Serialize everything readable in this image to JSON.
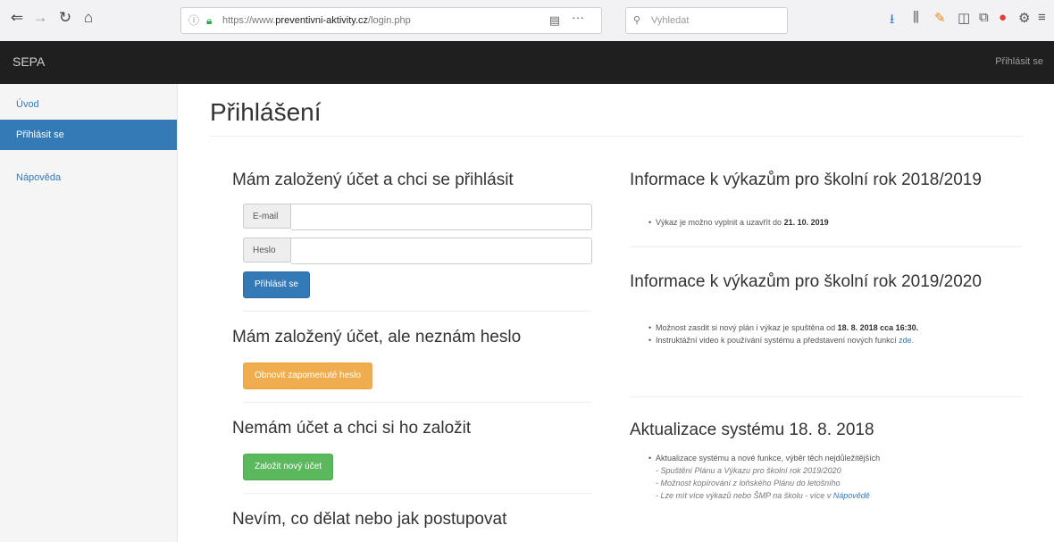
{
  "browser": {
    "url_prefix": "https://www.",
    "url_domain": "preventivni-aktivity.cz",
    "url_path": "/login.php",
    "search_placeholder": "Vyhledat"
  },
  "navbar": {
    "brand": "SEPA",
    "login_link": "Přihlásit se"
  },
  "sidebar": {
    "items": [
      {
        "label": "Úvod"
      },
      {
        "label": "Přihlásit se"
      },
      {
        "label": "Nápověda"
      }
    ]
  },
  "main": {
    "title": "Přihlášení",
    "login_section": {
      "heading": "Mám založený účet a chci se přihlásit",
      "email_label": "E-mail",
      "password_label": "Heslo",
      "submit_label": "Přihlásit se"
    },
    "forgot_section": {
      "heading": "Mám založený účet, ale neznám heslo",
      "button_label": "Obnovit zapomenuté heslo"
    },
    "register_section": {
      "heading": "Nemám účet a chci si ho založit",
      "button_label": "Založit nový účet"
    },
    "help_section": {
      "heading": "Nevím, co dělat nebo jak postupovat"
    },
    "info1": {
      "heading": "Informace k výkazům pro školní rok 2018/2019",
      "bullet_text": "Výkaz je možno vyplnit a uzavřít do ",
      "bullet_bold": "21. 10. 2019"
    },
    "info2": {
      "heading": "Informace k výkazům pro školní rok 2019/2020",
      "bullet1_text": "Možnost zasdit si nový plán i výkaz je spuštěna od ",
      "bullet1_bold": "18. 8. 2018 cca 16:30.",
      "bullet2_text": "Instruktážní video k používání systému a představení nových funkcí ",
      "bullet2_link": "zde."
    },
    "update": {
      "heading": "Aktualizace systému 18. 8. 2018",
      "bullet_text": "Aktualizace systému a nové funkce, výběr těch nejdůležitějších",
      "sub1": "- Spuštění Plánu a Výkazu pro školní rok 2019/2020",
      "sub2": "- Možnost kopírování z loňského Plánu do letošního",
      "sub3_text": "- Lze mít více výkazů nebo ŠMP na školu - více v ",
      "sub3_link": "Nápovědě"
    }
  }
}
